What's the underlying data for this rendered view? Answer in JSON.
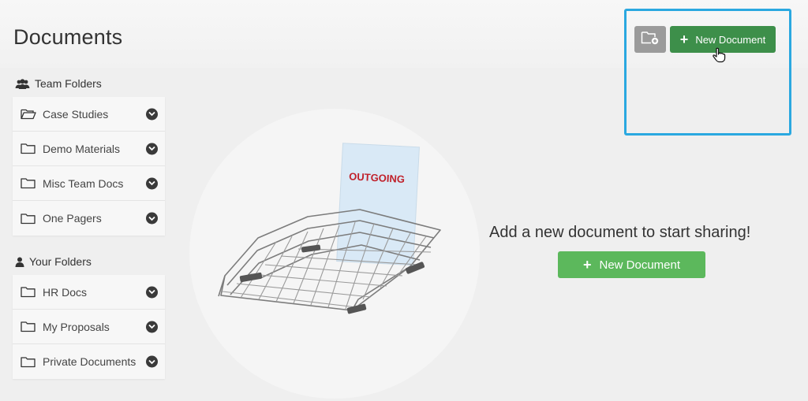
{
  "header": {
    "title": "Documents",
    "folder_add_icon": "folder-add-icon",
    "new_document_label": "New Document"
  },
  "team_folders": {
    "heading": "Team Folders",
    "icon": "group-icon",
    "items": [
      {
        "label": "Case Studies",
        "icon": "folder-open-icon"
      },
      {
        "label": "Demo Materials",
        "icon": "folder-icon"
      },
      {
        "label": "Misc Team Docs",
        "icon": "folder-icon"
      },
      {
        "label": "One Pagers",
        "icon": "folder-icon"
      }
    ]
  },
  "your_folders": {
    "heading": "Your Folders",
    "icon": "user-icon",
    "items": [
      {
        "label": "HR Docs",
        "icon": "folder-icon"
      },
      {
        "label": "My Proposals",
        "icon": "folder-icon"
      },
      {
        "label": "Private Documents",
        "icon": "folder-icon"
      }
    ]
  },
  "empty_state": {
    "tray_label": "OUTGOING",
    "message": "Add a new document to start sharing!",
    "button_label": "New Document"
  },
  "colors": {
    "green_dark": "#3d8f4a",
    "green_light": "#5cb85c",
    "highlight_blue": "#2aa8e0",
    "outgoing_red": "#c0202a"
  }
}
